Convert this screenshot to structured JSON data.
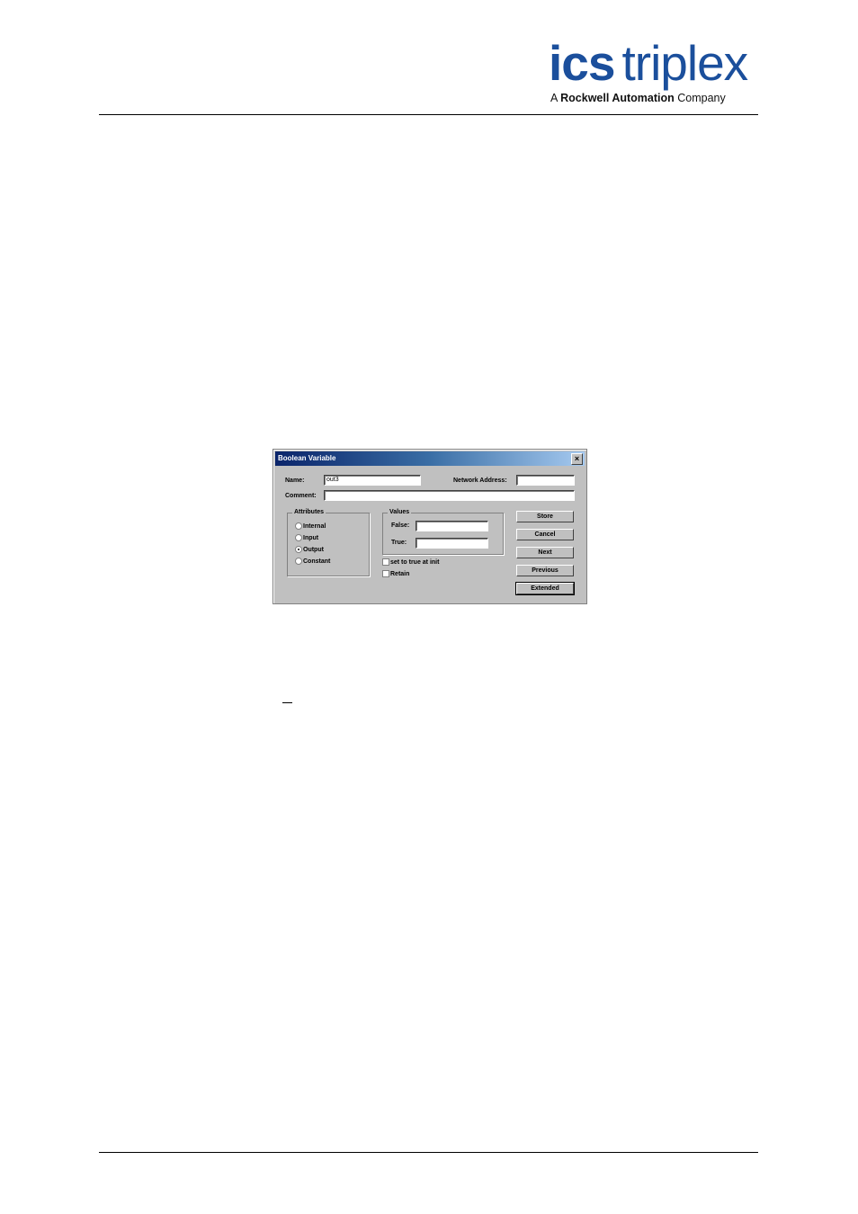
{
  "logo": {
    "brand_bold": "ics",
    "brand_light": "triplex",
    "tagline_pre": "A ",
    "tagline_bold": "Rockwell Automation",
    "tagline_post": " Company",
    "brand_color": "#1b4f9c"
  },
  "dialog": {
    "title": "Boolean Variable",
    "close_glyph": "×",
    "name_label": "Name:",
    "name_value": "out3",
    "network_address_label": "Network Address:",
    "network_address_value": "",
    "comment_label": "Comment:",
    "comment_value": "",
    "attributes": {
      "title": "Attributes",
      "options": [
        "Internal",
        "Input",
        "Output",
        "Constant"
      ],
      "selected": "Output"
    },
    "values": {
      "title": "Values",
      "false_label": "False:",
      "false_value": "",
      "true_label": "True:",
      "true_value": ""
    },
    "checkboxes": {
      "set_true_label": "set to true at init",
      "retain_label": "Retain"
    },
    "buttons": {
      "store": "Store",
      "cancel": "Cancel",
      "next": "Next",
      "previous": "Previous",
      "extended": "Extended"
    }
  }
}
